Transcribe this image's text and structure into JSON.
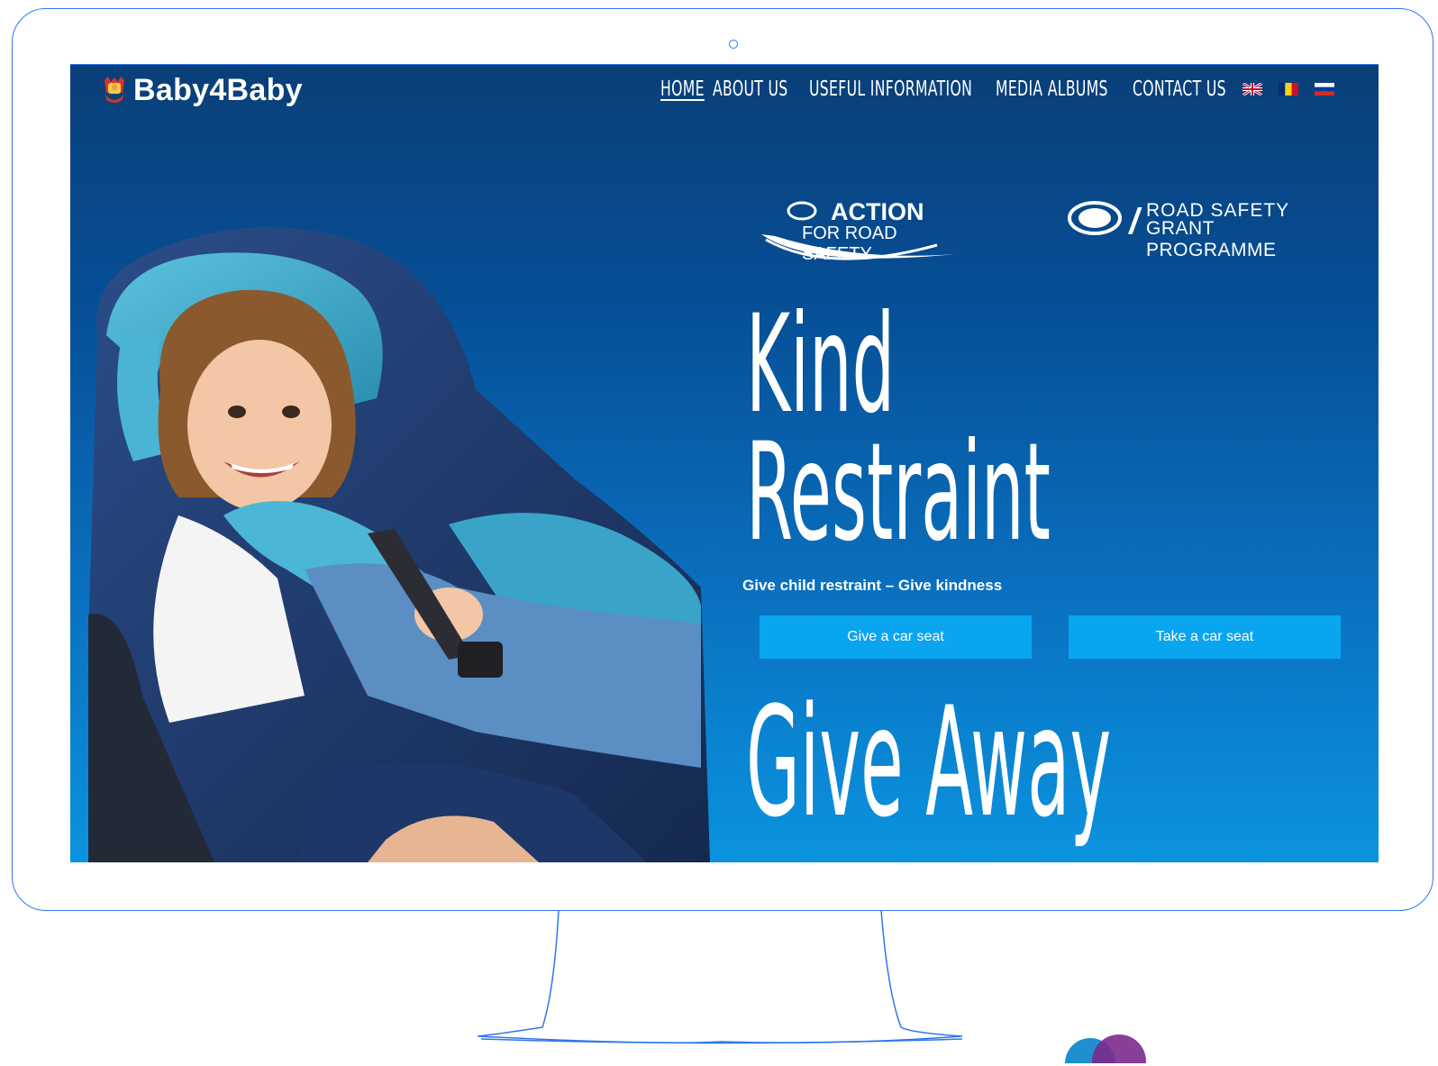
{
  "site": {
    "logo_text": "Baby4Baby"
  },
  "nav": {
    "items": [
      {
        "label": "HOME",
        "active": true
      },
      {
        "label": "ABOUT US"
      },
      {
        "label": "USEFUL INFORMATION"
      },
      {
        "label": "MEDIA ALBUMS"
      },
      {
        "label": "CONTACT US"
      }
    ],
    "flags": [
      "uk-flag-icon",
      "romania-flag-icon",
      "russia-flag-icon"
    ]
  },
  "sponsors": {
    "fia_action": {
      "mark": "FIA",
      "title": "ACTION",
      "sub": "FOR ROAD SAFETY"
    },
    "fia_grant": {
      "mark": "FIA",
      "line1": "ROAD SAFETY",
      "line2": "GRANT PROGRAMME"
    }
  },
  "hero": {
    "headline_1": "Kind",
    "headline_2": "Restraint",
    "tagline": "Give child restraint – Give kindness",
    "give_button": "Give a car seat",
    "take_button": "Take a car seat",
    "headline_3": "Give Away"
  },
  "colors": {
    "accent": "#0aa5ef",
    "outline": "#2e78ea",
    "bg_top": "#0a3f78",
    "bg_bottom": "#0b93df"
  }
}
